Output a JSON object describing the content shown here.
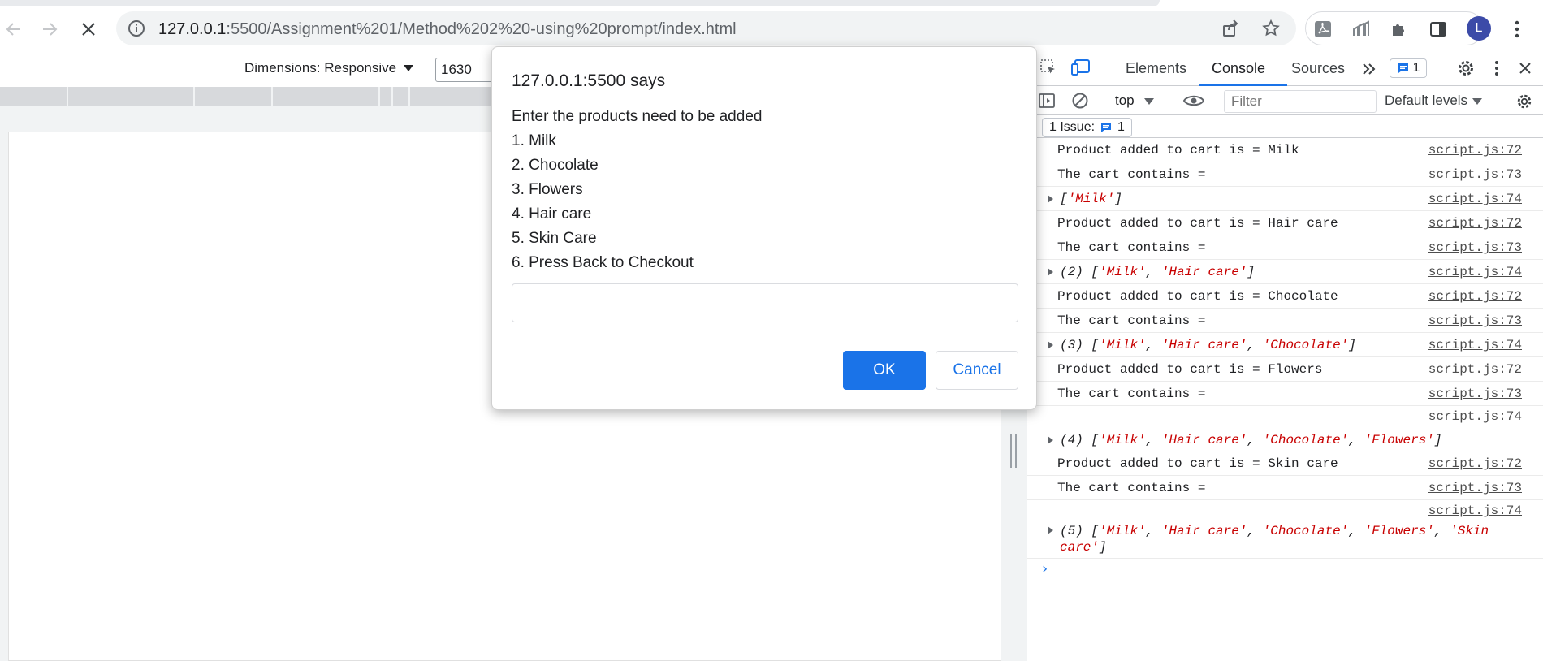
{
  "browser": {
    "url_host": "127.0.0.1",
    "url_rest": ":5500/Assignment%201/Method%202%20-using%20prompt/index.html",
    "avatar_initial": "L"
  },
  "device_toolbar": {
    "dimensions_label": "Dimensions: Responsive",
    "width_value": "1630"
  },
  "devtools": {
    "tabs": [
      "Elements",
      "Console",
      "Sources"
    ],
    "active_tab": "Console",
    "issues_badge_count": "1",
    "context": "top",
    "filter_placeholder": "Filter",
    "levels_label": "Default levels",
    "issues_button": "1 Issue:",
    "issues_button_count": "1"
  },
  "console": {
    "rows": [
      {
        "text": "Product added to cart is = Milk",
        "src": "script.js:72"
      },
      {
        "text": "The cart contains =",
        "src": "script.js:73"
      },
      {
        "prefix": "",
        "items": [
          "'Milk'"
        ],
        "src": "script.js:74"
      },
      {
        "text": "Product added to cart is = Hair care",
        "src": "script.js:72"
      },
      {
        "text": "The cart contains =",
        "src": "script.js:73"
      },
      {
        "prefix": "(2) ",
        "items": [
          "'Milk'",
          "'Hair care'"
        ],
        "src": "script.js:74"
      },
      {
        "text": "Product added to cart is = Chocolate",
        "src": "script.js:72"
      },
      {
        "text": "The cart contains =",
        "src": "script.js:73"
      },
      {
        "prefix": "(3) ",
        "items": [
          "'Milk'",
          "'Hair care'",
          "'Chocolate'"
        ],
        "src": "script.js:74"
      },
      {
        "text": "Product added to cart is = Flowers",
        "src": "script.js:72"
      },
      {
        "text": "The cart contains =",
        "src": "script.js:73"
      },
      {
        "prefix": "(4) ",
        "items": [
          "'Milk'",
          "'Hair care'",
          "'Chocolate'",
          "'Flowers'"
        ],
        "src": "script.js:74"
      },
      {
        "text": "Product added to cart is = Skin care",
        "src": "script.js:72"
      },
      {
        "text": "The cart contains =",
        "src": "script.js:73"
      },
      {
        "prefix": "(5) ",
        "items": [
          "'Milk'",
          "'Hair care'",
          "'Chocolate'",
          "'Flowers'",
          "'Skin care'"
        ],
        "src": "script.js:74"
      }
    ]
  },
  "dialog": {
    "title": "127.0.0.1:5500 says",
    "message_lines": [
      "Enter the products need to be added",
      "1. Milk",
      "2. Chocolate",
      "3. Flowers",
      "4. Hair care",
      "5. Skin Care",
      "6. Press Back to Checkout"
    ],
    "input_value": "",
    "ok_label": "OK",
    "cancel_label": "Cancel"
  },
  "colors": {
    "accent": "#1a73e8",
    "console_string": "#c80000"
  }
}
